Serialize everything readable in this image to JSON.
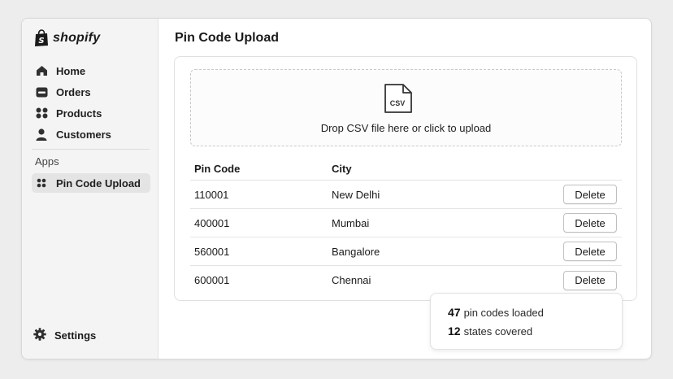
{
  "brand": {
    "name": "shopify",
    "icon": "shopping-bag-icon"
  },
  "sidebar": {
    "items": [
      {
        "label": "Home",
        "icon": "home-icon"
      },
      {
        "label": "Orders",
        "icon": "inbox-icon"
      },
      {
        "label": "Products",
        "icon": "grid-icon"
      },
      {
        "label": "Customers",
        "icon": "person-icon"
      }
    ],
    "apps_label": "Apps",
    "apps": [
      {
        "label": "Pin Code Upload",
        "icon": "apps-grid-icon",
        "active": true
      }
    ],
    "settings_label": "Settings"
  },
  "page": {
    "title": "Pin Code Upload"
  },
  "dropzone": {
    "icon_label": "CSV",
    "text": "Drop CSV file here or click to upload"
  },
  "table": {
    "headers": {
      "pin": "Pin Code",
      "city": "City"
    },
    "rows": [
      {
        "pin": "110001",
        "city": "New Delhi",
        "action": "Delete"
      },
      {
        "pin": "400001",
        "city": "Mumbai",
        "action": "Delete"
      },
      {
        "pin": "560001",
        "city": "Bangalore",
        "action": "Delete"
      },
      {
        "pin": "600001",
        "city": "Chennai",
        "action": "Delete"
      }
    ]
  },
  "stats": {
    "pin_count": "47",
    "pin_text": "pin codes loaded",
    "state_count": "12",
    "state_text": "states covered"
  },
  "colors": {
    "text": "#1a1a1a",
    "sidebar_bg": "#f4f4f4",
    "active_bg": "#e4e4e4",
    "page_bg": "#ededed"
  }
}
